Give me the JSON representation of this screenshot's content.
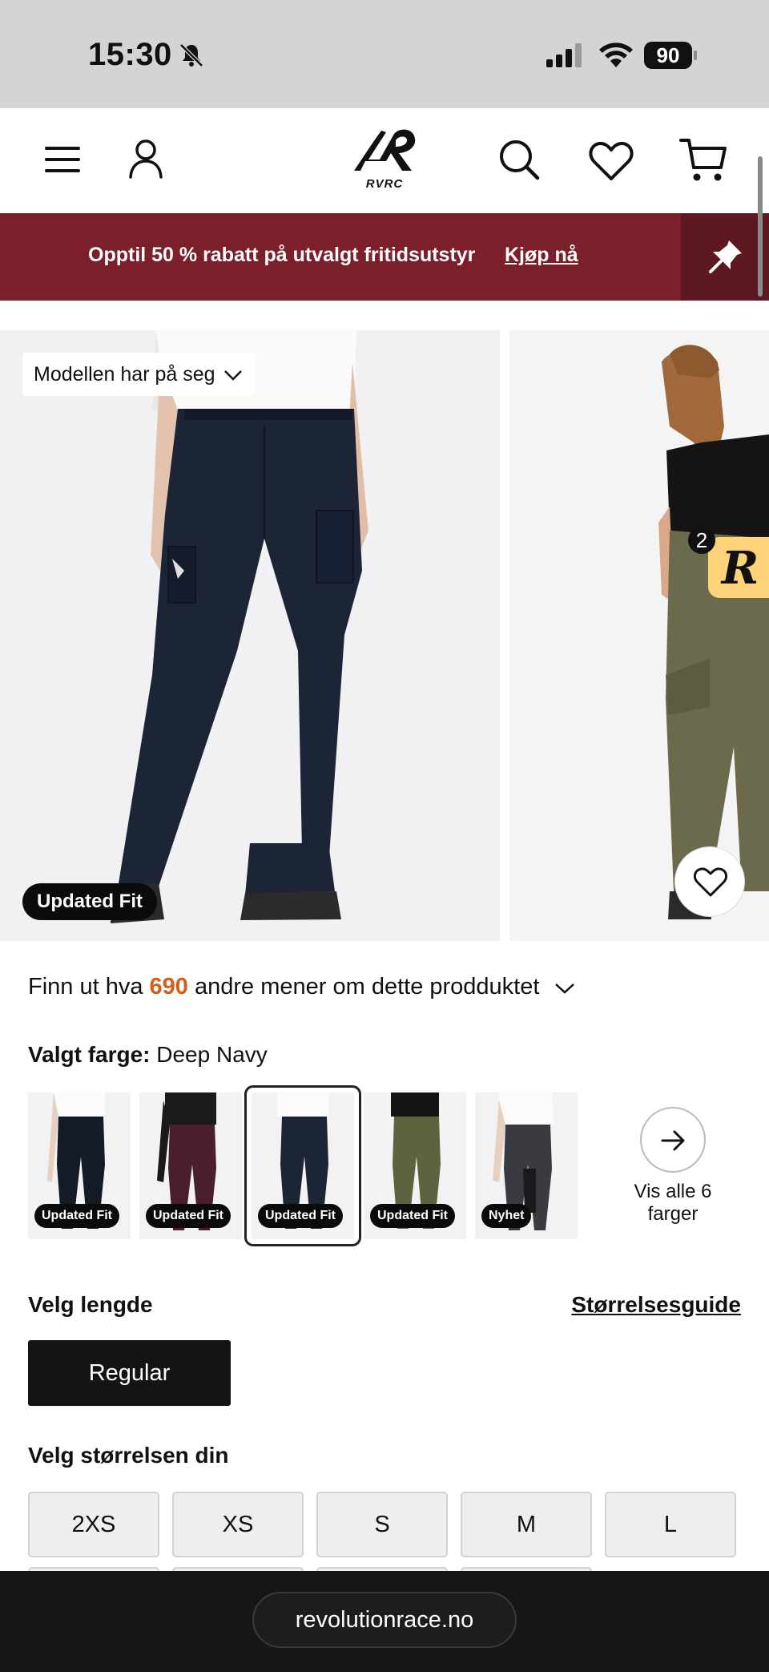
{
  "status_bar": {
    "time": "15:30",
    "battery": "90"
  },
  "header": {
    "logo_text": "RVRC"
  },
  "promo": {
    "text": "Opptil 50 % rabatt på utvalgt fritidsutstyr",
    "link": "Kjøp nå"
  },
  "gallery": {
    "model_chip": "Modellen har på seg",
    "badge": "Updated Fit",
    "notification_count": "2"
  },
  "reviews": {
    "prefix": "Finn ut hva",
    "count": "690",
    "suffix": "andre mener om dette prodduktet"
  },
  "colour": {
    "label": "Valgt farge:",
    "value": "Deep Navy",
    "swatches": [
      {
        "badge": "Updated Fit"
      },
      {
        "badge": "Updated Fit"
      },
      {
        "badge": "Updated Fit"
      },
      {
        "badge": "Updated Fit"
      },
      {
        "badge": "Nyhet"
      }
    ],
    "see_all": "Vis alle 6 farger"
  },
  "length": {
    "label": "Velg lengde",
    "size_guide": "Størrelsesguide",
    "options": [
      "Regular"
    ]
  },
  "size": {
    "label": "Velg størrelsen din",
    "options": [
      "2XS",
      "XS",
      "S",
      "M",
      "L"
    ]
  },
  "browser": {
    "url": "revolutionrace.no"
  }
}
